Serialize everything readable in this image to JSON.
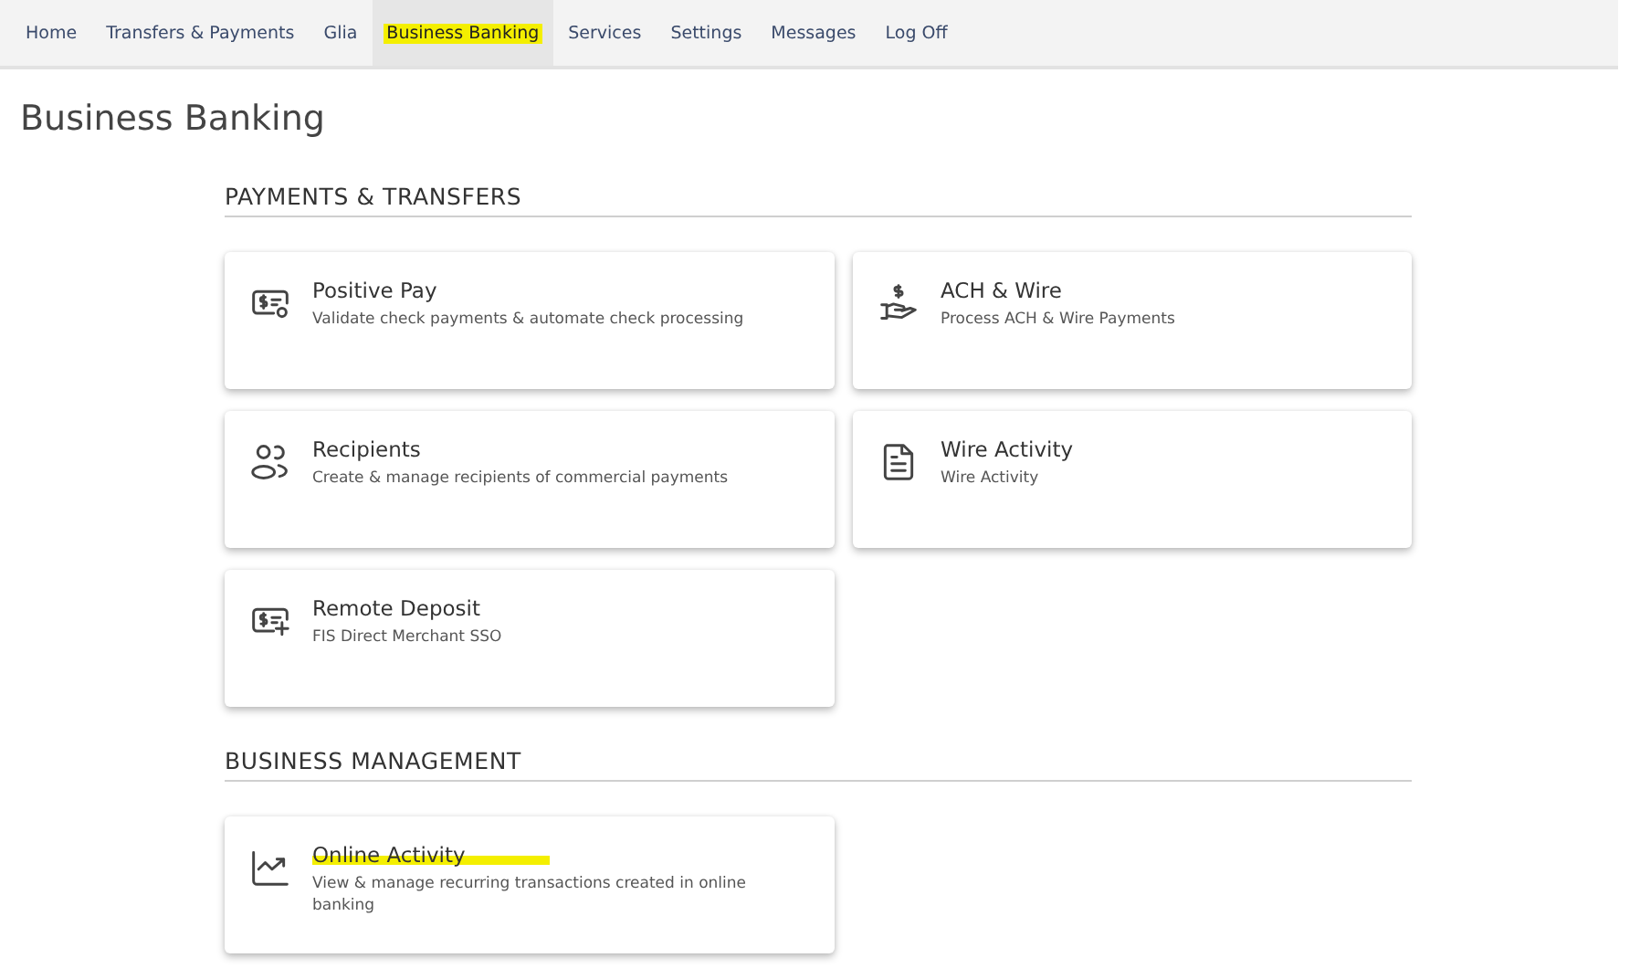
{
  "nav": [
    {
      "label": "Home",
      "selected": false,
      "highlighted": false
    },
    {
      "label": "Transfers & Payments",
      "selected": false,
      "highlighted": false
    },
    {
      "label": "Glia",
      "selected": false,
      "highlighted": false
    },
    {
      "label": "Business Banking",
      "selected": true,
      "highlighted": true
    },
    {
      "label": "Services",
      "selected": false,
      "highlighted": false
    },
    {
      "label": "Settings",
      "selected": false,
      "highlighted": false
    },
    {
      "label": "Messages",
      "selected": false,
      "highlighted": false
    },
    {
      "label": "Log Off",
      "selected": false,
      "highlighted": false
    }
  ],
  "page_title": "Business Banking",
  "sections": [
    {
      "heading": "PAYMENTS & TRANSFERS",
      "cards": [
        {
          "kind": "check",
          "title": "Positive Pay",
          "description": "Validate check payments & automate check processing",
          "highlighted": false
        },
        {
          "kind": "hand",
          "title": "ACH & Wire",
          "description": "Process ACH & Wire Payments",
          "highlighted": false
        },
        {
          "kind": "people",
          "title": "Recipients",
          "description": "Create & manage recipients of commercial payments",
          "highlighted": false
        },
        {
          "kind": "document",
          "title": "Wire Activity",
          "description": "Wire Activity",
          "highlighted": false
        },
        {
          "kind": "deposit",
          "title": "Remote Deposit",
          "description": "FIS Direct Merchant SSO",
          "highlighted": false
        }
      ]
    },
    {
      "heading": "BUSINESS MANAGEMENT",
      "cards": [
        {
          "kind": "chart",
          "title": "Online Activity",
          "description": "View & manage recurring transactions created in online banking",
          "highlighted": true
        }
      ]
    }
  ]
}
